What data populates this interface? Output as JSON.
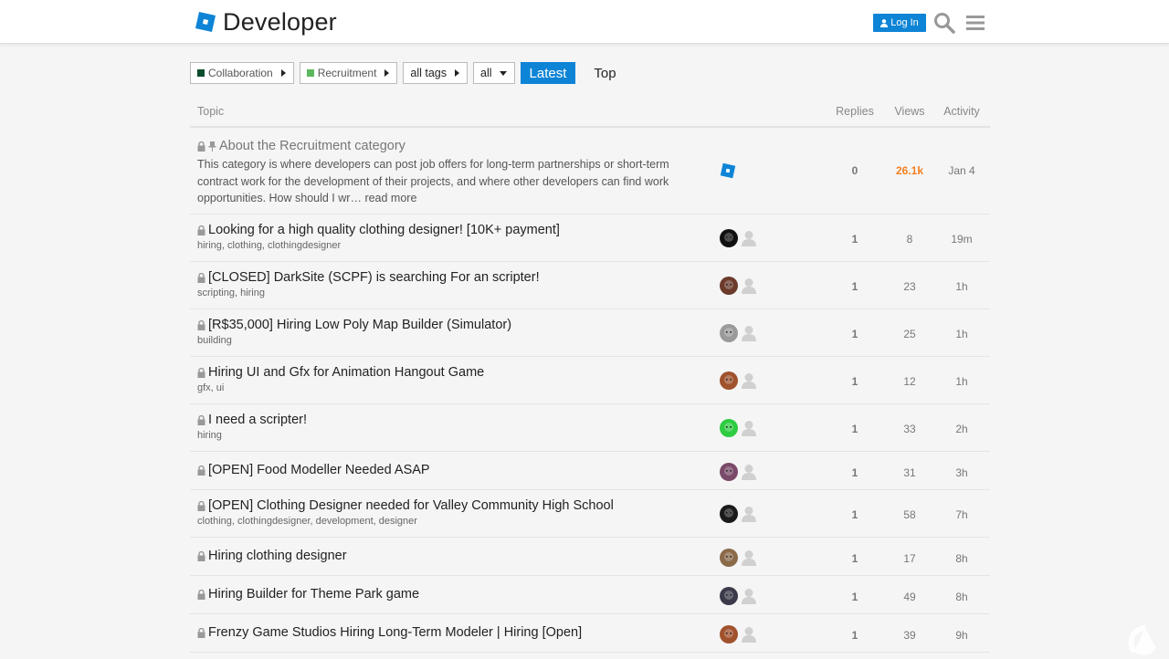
{
  "header": {
    "logo_text": "Developer",
    "login_label": "Log In",
    "colors": {
      "accent": "#0e84d6"
    }
  },
  "filters": {
    "category": {
      "label": "Collaboration",
      "color": "#0a4d2e"
    },
    "subcategory": {
      "label": "Recruitment",
      "color": "#5cb85c"
    },
    "tags": "all tags",
    "status": "all",
    "nav": [
      {
        "label": "Latest",
        "active": true
      },
      {
        "label": "Top",
        "active": false
      }
    ]
  },
  "table": {
    "headers": {
      "topic": "Topic",
      "replies": "Replies",
      "views": "Views",
      "activity": "Activity"
    },
    "pinned": {
      "title": "About the Recruitment category",
      "excerpt": "This category is where developers can post job offers for long-term partnerships or short-term contract work for the development of their projects, and where other developers can find work opportunities. How should I wr…",
      "read_more": "read more",
      "replies": "0",
      "views": "26.1k",
      "activity": "Jan 4"
    },
    "rows": [
      {
        "title": "Looking for a high quality clothing designer! [10K+ payment]",
        "tags": "hiring, clothing, clothingdesigner",
        "replies": "1",
        "views": "8",
        "activity": "19m",
        "avatar": "#111111"
      },
      {
        "title": "[CLOSED] DarkSite (SCPF) is searching For an scripter!",
        "tags": "scripting, hiring",
        "replies": "1",
        "views": "23",
        "activity": "1h",
        "avatar": "#6b3a2a"
      },
      {
        "title": "[R$35,000] Hiring Low Poly Map Builder (Simulator)",
        "tags": "building",
        "replies": "1",
        "views": "25",
        "activity": "1h",
        "avatar": "#9a9a9a"
      },
      {
        "title": "Hiring UI and Gfx for Animation Hangout Game",
        "tags": "gfx, ui",
        "replies": "1",
        "views": "12",
        "activity": "1h",
        "avatar": "#a0522d"
      },
      {
        "title": "I need a scripter!",
        "tags": "hiring",
        "replies": "1",
        "views": "33",
        "activity": "2h",
        "avatar": "#2ecc40"
      },
      {
        "title": "[OPEN] Food Modeller Needed ASAP",
        "tags": "",
        "replies": "1",
        "views": "31",
        "activity": "3h",
        "avatar": "#7a4a6a"
      },
      {
        "title": "[OPEN] Clothing Designer needed for Valley Community High School",
        "tags": "clothing, clothingdesigner, development, designer",
        "replies": "1",
        "views": "58",
        "activity": "7h",
        "avatar": "#1a1a1a"
      },
      {
        "title": "Hiring clothing designer",
        "tags": "",
        "replies": "1",
        "views": "17",
        "activity": "8h",
        "avatar": "#8b6a4a"
      },
      {
        "title": "Hiring Builder for Theme Park game",
        "tags": "",
        "replies": "1",
        "views": "49",
        "activity": "8h",
        "avatar": "#3a3a4a"
      },
      {
        "title": "Frenzy Game Studios Hiring Long-Term Modeler | Hiring [Open]",
        "tags": "",
        "replies": "1",
        "views": "39",
        "activity": "9h",
        "avatar": "#a0522d"
      }
    ]
  }
}
